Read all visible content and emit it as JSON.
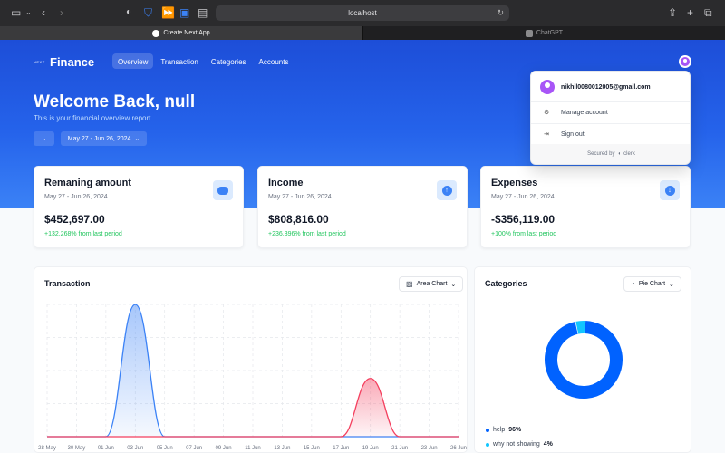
{
  "browser": {
    "url": "localhost",
    "tabs": [
      {
        "label": "Create Next App",
        "active": true
      },
      {
        "label": "ChatGPT",
        "active": false
      }
    ]
  },
  "header": {
    "logo_text": "NEXT.",
    "brand": "Finance",
    "nav": [
      {
        "label": "Overview",
        "active": true
      },
      {
        "label": "Transaction",
        "active": false
      },
      {
        "label": "Categories",
        "active": false
      },
      {
        "label": "Accounts",
        "active": false
      }
    ]
  },
  "hero": {
    "welcome": "Welcome Back, null",
    "subtitle": "This is your financial overview report",
    "date_range": "May 27 - Jun 26, 2024"
  },
  "cards": [
    {
      "title": "Remaning amount",
      "range": "May 27 - Jun 26, 2024",
      "amount": "$452,697.00",
      "change": "+132,268% from last period",
      "icon": "piggy-bank-icon"
    },
    {
      "title": "Income",
      "range": "May 27 - Jun 26, 2024",
      "amount": "$808,816.00",
      "change": "+236,396% from last period",
      "icon": "arrow-up-circle-icon"
    },
    {
      "title": "Expenses",
      "range": "May 27 - Jun 26, 2024",
      "amount": "-$356,119.00",
      "change": "+100% from last period",
      "icon": "arrow-down-circle-icon"
    }
  ],
  "transaction": {
    "title": "Transaction",
    "chart_select": "Area Chart"
  },
  "categories": {
    "title": "Categories",
    "chart_select": "Pie Chart"
  },
  "dropdown": {
    "email": "nikhil0080012005@gmail.com",
    "manage": "Manage account",
    "signout": "Sign out",
    "footer_prefix": "Secured by",
    "footer_brand": "clerk"
  },
  "colors": {
    "accent": "#2563eb",
    "income": "#3b82f6",
    "expense": "#f43f5e",
    "positive": "#22c55e"
  },
  "chart_data": [
    {
      "type": "area",
      "title": "Transaction",
      "x": [
        "28 May",
        "30 May",
        "01 Jun",
        "03 Jun",
        "05 Jun",
        "07 Jun",
        "09 Jun",
        "11 Jun",
        "13 Jun",
        "15 Jun",
        "17 Jun",
        "19 Jun",
        "21 Jun",
        "23 Jun",
        "26 Jun"
      ],
      "series": [
        {
          "name": "income",
          "values": [
            0,
            0,
            0,
            808816,
            0,
            0,
            0,
            0,
            0,
            0,
            0,
            0,
            0,
            0,
            0
          ]
        },
        {
          "name": "expenses",
          "values": [
            0,
            0,
            0,
            0,
            0,
            0,
            0,
            0,
            0,
            0,
            0,
            356119,
            0,
            0,
            0
          ]
        }
      ]
    },
    {
      "type": "pie",
      "title": "Categories",
      "slices": [
        {
          "label": "help",
          "value": 96,
          "display": "96%",
          "color": "#0062ff"
        },
        {
          "label": "why not showing",
          "value": 4,
          "display": "4%",
          "color": "#12c6ff"
        }
      ]
    }
  ]
}
